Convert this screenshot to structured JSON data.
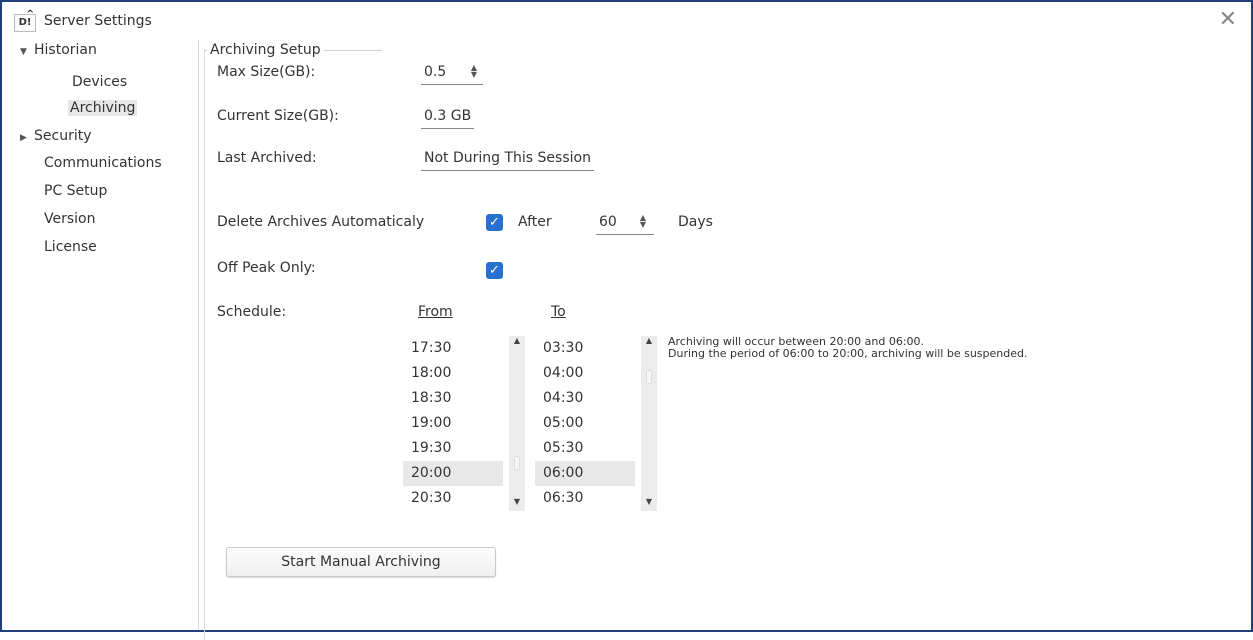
{
  "window": {
    "title": "Server Settings",
    "app_icon_text": "D!",
    "close_glyph": "✕"
  },
  "sidebar": {
    "items": [
      {
        "label": "Historian",
        "expander": "▼"
      },
      {
        "label": "Devices"
      },
      {
        "label": "Archiving"
      },
      {
        "label": "Security",
        "expander": "▶"
      },
      {
        "label": "Communications"
      },
      {
        "label": "PC Setup"
      },
      {
        "label": "Version"
      },
      {
        "label": "License"
      }
    ]
  },
  "archiving": {
    "group_title": "Archiving Setup",
    "max_size_label": "Max Size(GB):",
    "max_size_value": "0.5",
    "current_size_label": "Current Size(GB):",
    "current_size_value": "0.3 GB",
    "last_archived_label": "Last Archived:",
    "last_archived_value": "Not During This Session",
    "delete_auto_label": "Delete Archives Automaticaly",
    "delete_auto_checked": true,
    "after_label": "After",
    "after_value": "60",
    "days_label": "Days",
    "off_peak_label": "Off Peak Only:",
    "off_peak_checked": true,
    "schedule_label": "Schedule:",
    "from_header": "From",
    "to_header": "To",
    "from_times": [
      "17:30",
      "18:00",
      "18:30",
      "19:00",
      "19:30",
      "20:00",
      "20:30"
    ],
    "to_times": [
      "03:30",
      "04:00",
      "04:30",
      "05:00",
      "05:30",
      "06:00",
      "06:30"
    ],
    "from_selected": "20:00",
    "to_selected": "06:00",
    "note_line1": "Archiving will occur between 20:00 and 06:00.",
    "note_line2": "During the period of 06:00 to 20:00, archiving will be suspended.",
    "manual_button": "Start Manual Archiving"
  },
  "icons": {
    "check": "✓",
    "spin_up": "▲",
    "spin_down": "▼",
    "close": "close-icon"
  },
  "colors": {
    "accent": "#2a70d0",
    "border": "#1f3f7a",
    "selected_bg": "#e6e6e6"
  }
}
